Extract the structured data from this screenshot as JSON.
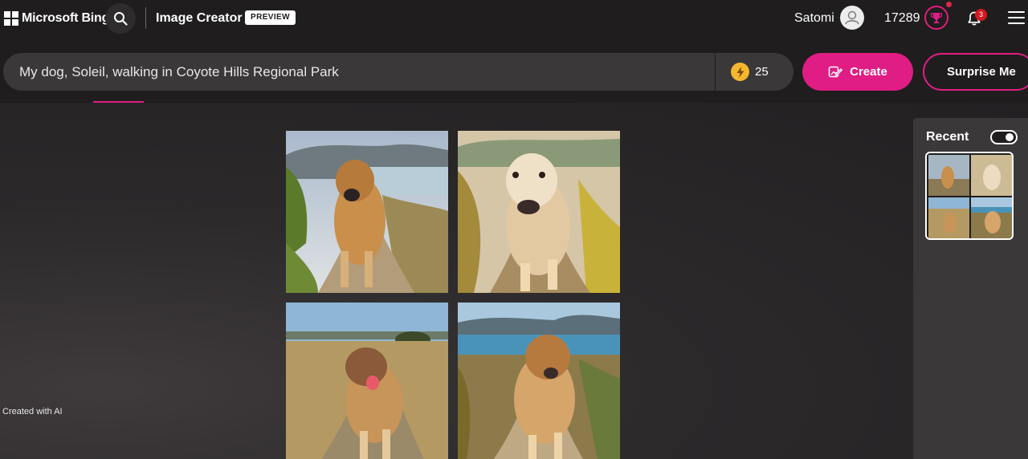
{
  "header": {
    "brand": "Microsoft Bing",
    "app_title": "Image Creator",
    "badge": "PREVIEW",
    "user_name": "Satomi",
    "points": "17289",
    "notification_count": "3"
  },
  "prompt": {
    "value": "My dog, Soleil, walking in Coyote Hills Regional Park",
    "boosts": "25",
    "create_label": "Create",
    "surprise_label": "Surprise Me"
  },
  "results": {
    "images": [
      {
        "name": "generated-image-1",
        "icon": "dog-photo"
      },
      {
        "name": "generated-image-2",
        "icon": "dog-photo"
      },
      {
        "name": "generated-image-3",
        "icon": "dog-photo"
      },
      {
        "name": "generated-image-4",
        "icon": "dog-photo"
      }
    ],
    "footer_note": "Created with AI"
  },
  "recent": {
    "title": "Recent",
    "toggle_on": true
  },
  "colors": {
    "accent": "#e01d84",
    "background": "#1f1d1e",
    "surface": "#3a3839",
    "boost": "#f5b730"
  }
}
